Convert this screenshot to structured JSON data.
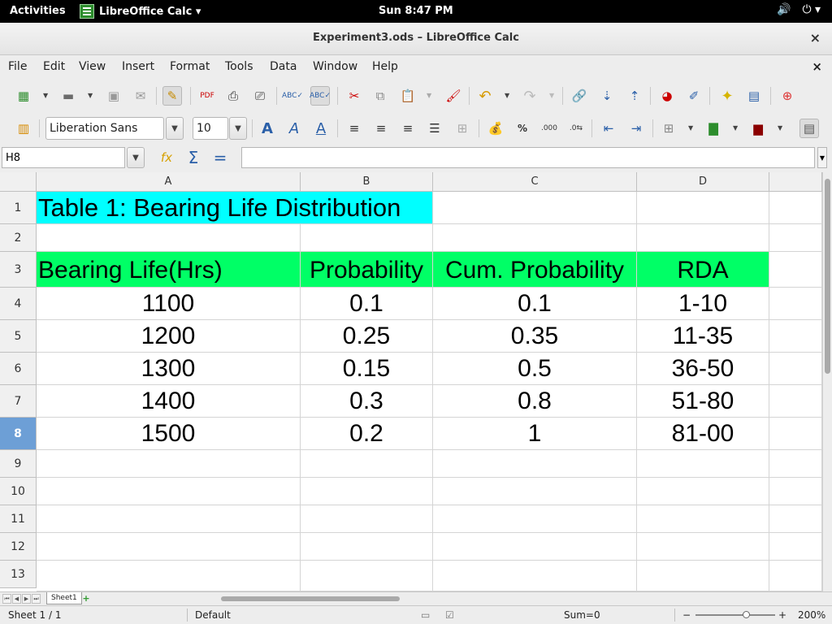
{
  "topbar": {
    "activities": "Activities",
    "app_name": "LibreOffice Calc ▾",
    "clock": "Sun  8:47 PM",
    "volume_icon": "volume-icon",
    "power_icon": "power-icon"
  },
  "window": {
    "title": "Experiment3.ods – LibreOffice Calc",
    "close": "×"
  },
  "menu": {
    "items": [
      "File",
      "Edit",
      "View",
      "Insert",
      "Format",
      "Tools",
      "Data",
      "Window",
      "Help"
    ],
    "doc_close": "×"
  },
  "toolbar2": {
    "font_name": "Liberation Sans",
    "font_size": "10"
  },
  "formula_bar": {
    "cell_ref": "H8",
    "formula": ""
  },
  "grid": {
    "columns": [
      "A",
      "B",
      "C",
      "D"
    ],
    "rows": [
      "1",
      "2",
      "3",
      "4",
      "5",
      "6",
      "7",
      "8",
      "9",
      "10",
      "11",
      "12",
      "13"
    ],
    "selected_row": "8",
    "title": "Table 1: Bearing Life Distribution",
    "headers": [
      "Bearing Life(Hrs)",
      "Probability",
      "Cum. Probability",
      "RDA"
    ],
    "data": [
      [
        "1100",
        "0.1",
        "0.1",
        "1-10"
      ],
      [
        "1200",
        "0.25",
        "0.35",
        "11-35"
      ],
      [
        "1300",
        "0.15",
        "0.5",
        "36-50"
      ],
      [
        "1400",
        "0.3",
        "0.8",
        "51-80"
      ],
      [
        "1500",
        "0.2",
        "1",
        "81-00"
      ]
    ],
    "colors": {
      "title_bg": "#00ffff",
      "header_bg": "#00ff66",
      "selected_header": "#6d9fd6"
    }
  },
  "tabs": {
    "sheet_name": "Sheet1",
    "add": "+"
  },
  "status": {
    "sheet": "Sheet 1 / 1",
    "style": "Default",
    "sum": "Sum=0",
    "zoom": "200%",
    "zoom_minus": "−",
    "zoom_plus": "+"
  }
}
